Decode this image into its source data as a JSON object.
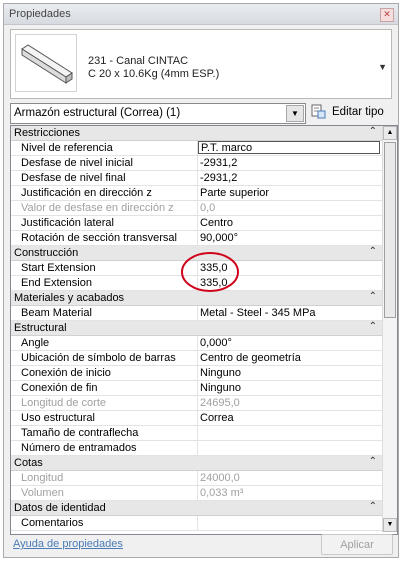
{
  "window": {
    "title": "Propiedades"
  },
  "type": {
    "line1": "231 - Canal CINTAC",
    "line2": "C 20 x 10.6Kg (4mm ESP.)"
  },
  "selector": {
    "value": "Armazón estructural (Correa) (1)",
    "edit_type_label": "Editar tipo"
  },
  "sections": {
    "restricciones": "Restricciones",
    "construccion": "Construcción",
    "materiales": "Materiales y acabados",
    "estructural": "Estructural",
    "cotas": "Cotas",
    "identidad": "Datos de identidad"
  },
  "rows": {
    "nivel_ref": {
      "name": "Nivel de referencia",
      "value": "P.T. marco"
    },
    "desfase_ini": {
      "name": "Desfase de nivel inicial",
      "value": "-2931,2"
    },
    "desfase_fin": {
      "name": "Desfase de nivel final",
      "value": "-2931,2"
    },
    "just_z": {
      "name": "Justificación en dirección z",
      "value": "Parte superior"
    },
    "valor_desfase": {
      "name": "Valor de desfase en dirección z",
      "value": "0,0"
    },
    "just_lat": {
      "name": "Justificación lateral",
      "value": "Centro"
    },
    "rotacion": {
      "name": "Rotación de sección transversal",
      "value": "90,000°"
    },
    "start_ext": {
      "name": "Start Extension",
      "value": "335,0"
    },
    "end_ext": {
      "name": "End Extension",
      "value": "335,0"
    },
    "beam_mat": {
      "name": "Beam Material",
      "value": "Metal - Steel - 345 MPa"
    },
    "angle": {
      "name": "Angle",
      "value": "0,000°"
    },
    "ubicacion": {
      "name": "Ubicación de símbolo de barras",
      "value": "Centro de geometría"
    },
    "con_inicio": {
      "name": "Conexión de inicio",
      "value": "Ninguno"
    },
    "con_fin": {
      "name": "Conexión de fin",
      "value": "Ninguno"
    },
    "long_corte": {
      "name": "Longitud de corte",
      "value": "24695,0"
    },
    "uso": {
      "name": "Uso estructural",
      "value": "Correa"
    },
    "contraflecha": {
      "name": "Tamaño de contraflecha",
      "value": ""
    },
    "entramados": {
      "name": "Número de entramados",
      "value": ""
    },
    "longitud": {
      "name": "Longitud",
      "value": "24000,0"
    },
    "volumen": {
      "name": "Volumen",
      "value": "0,033 m³"
    },
    "comentarios": {
      "name": "Comentarios",
      "value": ""
    }
  },
  "footer": {
    "help_link": "Ayuda de propiedades",
    "apply_label": "Aplicar"
  },
  "colors": {
    "annotation_circle": "#d0021b",
    "link": "#4a7bb7"
  }
}
